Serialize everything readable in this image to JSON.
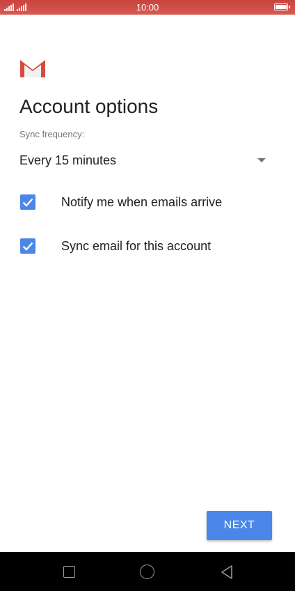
{
  "status_bar": {
    "time": "10:00"
  },
  "page": {
    "title": "Account options"
  },
  "sync": {
    "label": "Sync frequency:",
    "selected_value": "Every 15 minutes"
  },
  "options": [
    {
      "label": "Notify me when emails arrive",
      "checked": true
    },
    {
      "label": "Sync email for this account",
      "checked": true
    }
  ],
  "actions": {
    "next_label": "NEXT"
  },
  "colors": {
    "accent": "#4a87e8",
    "status_bar": "#c9433d",
    "gmail_red": "#d54b3d"
  },
  "icons": {
    "logo": "gmail-logo-icon",
    "dropdown": "dropdown-caret-icon",
    "check": "checkmark-icon",
    "nav": [
      "recent-apps-icon",
      "home-icon",
      "back-icon"
    ]
  }
}
